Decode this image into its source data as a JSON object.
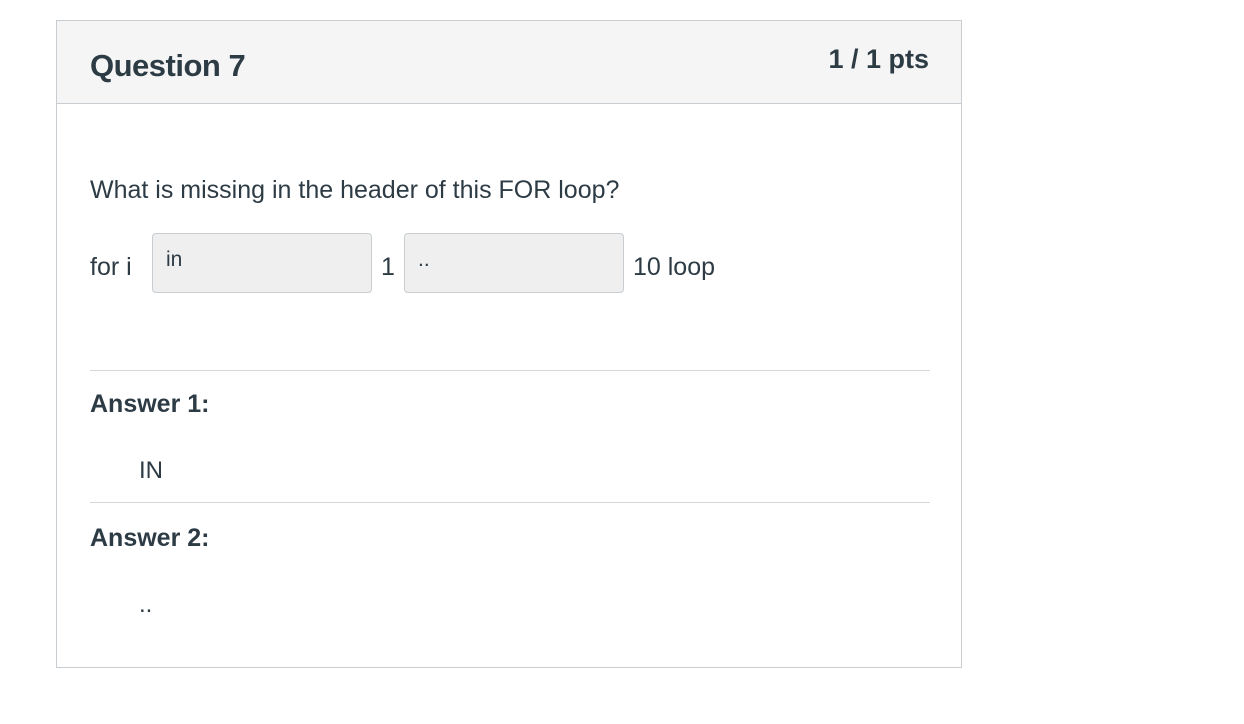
{
  "question": {
    "title": "Question 7",
    "points": "1 / 1 pts",
    "prompt": "What is missing in the header of this FOR loop?"
  },
  "code": {
    "token_for": "for i",
    "blank1_value": "in",
    "token_start": "1",
    "blank2_value": "..",
    "token_end": "10 loop"
  },
  "answers": [
    {
      "label": "Answer 1:",
      "value": "IN"
    },
    {
      "label": "Answer 2:",
      "value": ".."
    }
  ]
}
